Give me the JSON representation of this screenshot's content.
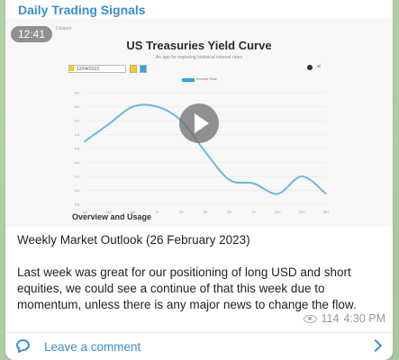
{
  "channel": {
    "name": "Daily Trading Signals"
  },
  "media": {
    "duration": "12:41",
    "tiny_header": "Dataset",
    "chart_title": "US Treasuries Yield Curve",
    "chart_subtitle": "An app for exploring historical interest rates",
    "date_value": "12/04/2023",
    "legend_label": "Interest Rate",
    "section_heading": "Overview and Usage",
    "play_icon": "play-icon"
  },
  "chart_data": {
    "type": "line",
    "x": [
      "1M",
      "3M",
      "6M",
      "1Y",
      "2Y",
      "3Y",
      "5Y",
      "7Y",
      "10Y",
      "20Y",
      "30Y"
    ],
    "series": [
      {
        "values": [
          4.7,
          4.95,
          5.2,
          5.2,
          5.0,
          4.55,
          4.15,
          4.1,
          3.95,
          4.2,
          3.95
        ]
      }
    ],
    "ylim": [
      3.8,
      5.4
    ],
    "color": "#6ab8e0"
  },
  "message": {
    "line1": "Weekly Market Outlook (26 February 2023)",
    "body": "Last week was great for our positioning of long USD and short equities, we could see a continue of that this week due to momentum, unless there is any major news to change the flow."
  },
  "meta": {
    "views": "114",
    "time": "4:30 PM"
  },
  "comments": {
    "label": "Leave a comment"
  },
  "colors": {
    "accent": "#3a8fd0",
    "meta": "#999999"
  }
}
